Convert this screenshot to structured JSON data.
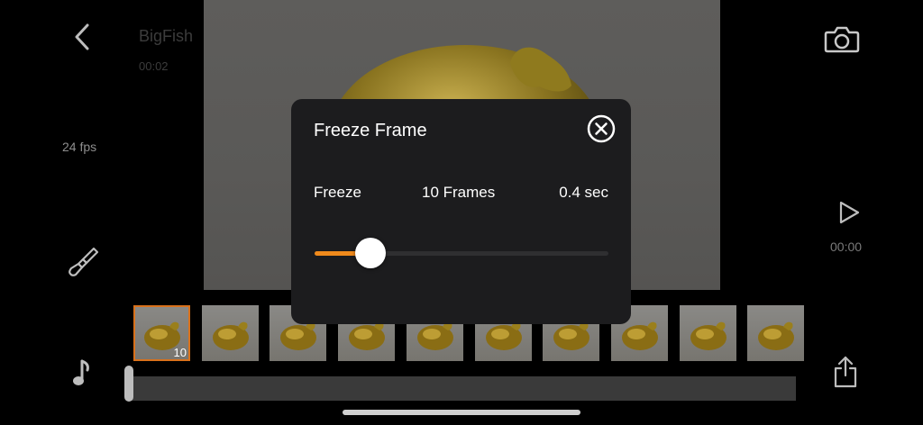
{
  "header": {
    "title": "BigFish",
    "time": "00:02"
  },
  "sidebar_left": {
    "fps": "24 fps"
  },
  "sidebar_right": {
    "play_time": "00:00"
  },
  "dialog": {
    "title": "Freeze Frame",
    "freeze_label": "Freeze",
    "frames_label": "10 Frames",
    "seconds_label": "0.4 sec",
    "slider_value": 0.19
  },
  "filmstrip": {
    "selected_badge": "10",
    "thumbnail_count": 10
  },
  "colors": {
    "accent": "#f08a1c",
    "dialog_bg": "#1c1c1e"
  },
  "icons": [
    "back-icon",
    "camera-icon",
    "paintbrush-icon",
    "play-icon",
    "music-note-icon",
    "share-icon",
    "close-icon"
  ]
}
